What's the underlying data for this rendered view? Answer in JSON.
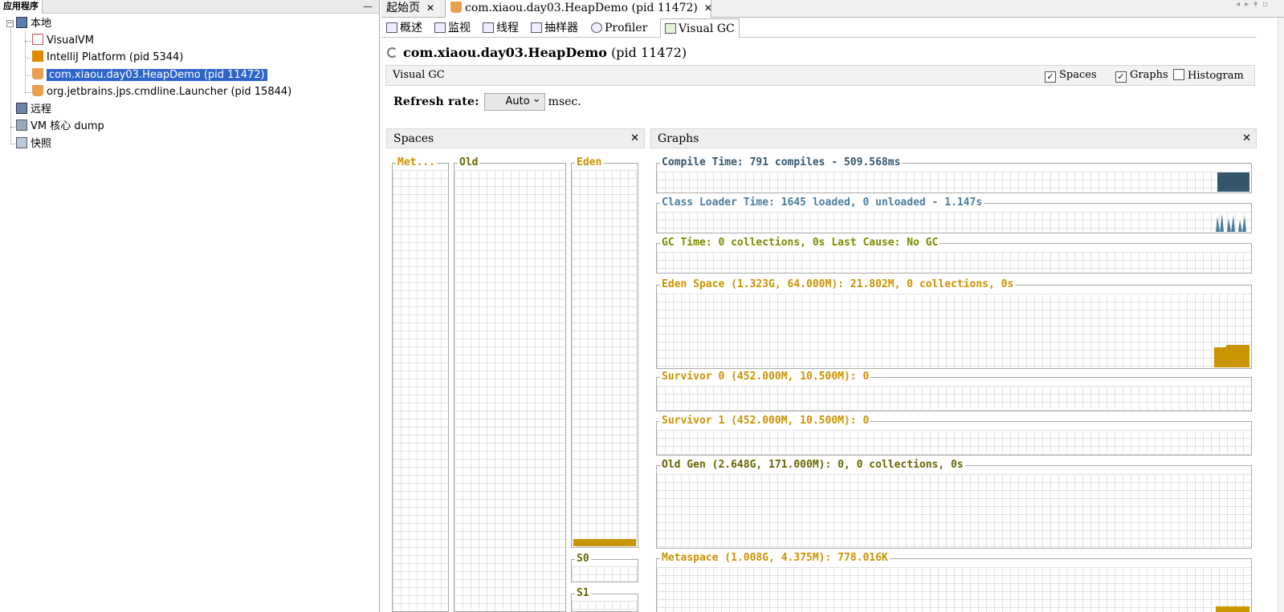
{
  "left_panel": {
    "tab_label": "应用程序",
    "minimize_glyph": "—",
    "tree": {
      "local": "本地",
      "apps": [
        {
          "label": "VisualVM"
        },
        {
          "label": "IntelliJ Platform (pid 5344)"
        },
        {
          "label": "com.xiaou.day03.HeapDemo (pid 11472)"
        },
        {
          "label": "org.jetbrains.jps.cmdline.Launcher (pid 15844)"
        }
      ],
      "remote": "远程",
      "vm_dump": "VM 核心 dump",
      "snapshots": "快照"
    }
  },
  "doc_tabs": [
    {
      "label": "起始页"
    },
    {
      "label": "com.xiaou.day03.HeapDemo (pid 11472)"
    }
  ],
  "sub_tabs": [
    {
      "label": "概述"
    },
    {
      "label": "监视"
    },
    {
      "label": "线程"
    },
    {
      "label": "抽样器"
    },
    {
      "label": "Profiler"
    },
    {
      "label": "Visual GC"
    }
  ],
  "main": {
    "title_main": "com.xiaou.day03.HeapDemo",
    "title_pid": "(pid 11472)",
    "visual_gc_label": "Visual GC",
    "options": {
      "spaces": "Spaces",
      "graphs": "Graphs",
      "histogram": "Histogram",
      "spaces_checked": true,
      "graphs_checked": true,
      "histogram_checked": false
    },
    "refresh_label": "Refresh rate:",
    "refresh_value": "Auto",
    "refresh_unit": "msec."
  },
  "spaces_panel": {
    "title": "Spaces",
    "meta": "Met...",
    "old": "Old",
    "eden": "Eden",
    "s0": "S0",
    "s1": "S1",
    "eden_fill_fraction": 0.02
  },
  "graphs_panel": {
    "title": "Graphs",
    "compile_time": "Compile Time: 791 compiles - 509.568ms",
    "class_loader": "Class Loader Time: 1645 loaded, 0 unloaded - 1.147s",
    "gc_time": "GC Time: 0 collections, 0s Last Cause: No GC",
    "eden_space": "Eden Space (1.323G, 64.000M): 21.802M, 0 collections, 0s",
    "survivor0": "Survivor 0 (452.000M, 10.500M): 0",
    "survivor1": "Survivor 1 (452.000M, 10.500M): 0",
    "old_gen": "Old Gen (2.648G, 171.000M): 0, 0 collections, 0s",
    "metaspace": "Metaspace (1.008G, 4.375M): 778.016K"
  },
  "colors": {
    "selection": "#2f65ca",
    "compile": "#34566c",
    "classloader": "#4b7d9b",
    "gc": "#7c8a00",
    "memory": "#cc9200"
  }
}
